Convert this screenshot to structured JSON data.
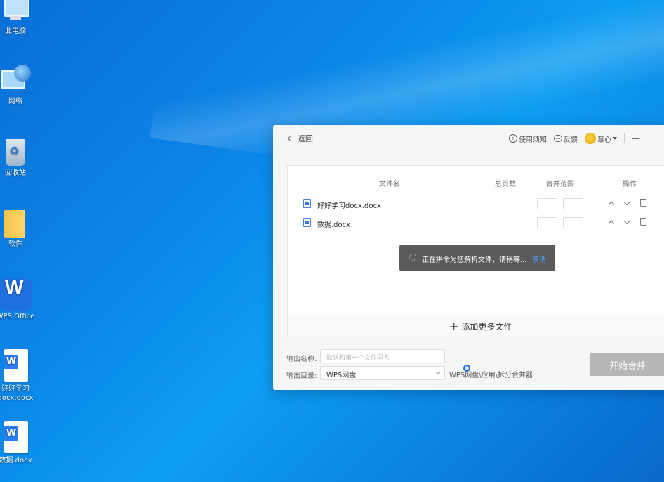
{
  "desktop": {
    "icons": [
      {
        "label": "此电脑",
        "icon": "this-pc-icon"
      },
      {
        "label": "网络",
        "icon": "network-icon"
      },
      {
        "label": "回收站",
        "icon": "recycle-bin-icon"
      },
      {
        "label": "软件",
        "icon": "folder-icon"
      },
      {
        "label": "WPS Office",
        "icon": "wps-office-icon"
      },
      {
        "label_line1": "好好学习",
        "label_line2": "docx.docx",
        "icon": "word-doc-icon"
      },
      {
        "label": "数据.docx",
        "icon": "word-doc-icon"
      }
    ]
  },
  "app": {
    "back_label": "返回",
    "help_label": "使用须知",
    "feedback_label": "反馈",
    "user_name": "章心",
    "minimize": "—",
    "table": {
      "headers": {
        "filename": "文件名",
        "pages": "总页数",
        "range": "合并范围",
        "actions": "操作"
      },
      "rows": [
        {
          "filename": "好好学习docx.docx"
        },
        {
          "filename": "数据.docx"
        }
      ]
    },
    "toast": {
      "message": "正在拼命为您解析文件，请稍等...",
      "cancel": "取消"
    },
    "add_more_label": "添加更多文件",
    "output": {
      "name_label": "输出名称:",
      "name_placeholder": "默认和第一个文件同名",
      "dir_label": "输出目录:",
      "dir_value": "WPS网盘",
      "dir_path": "WPS网盘\\应用\\拆分合并器"
    },
    "start_button": "开始合并"
  },
  "colors": {
    "desktop_blue": "#0b86e8",
    "start_button_disabled": "#b6b6b6",
    "cancel_link": "#4aa3ff"
  }
}
